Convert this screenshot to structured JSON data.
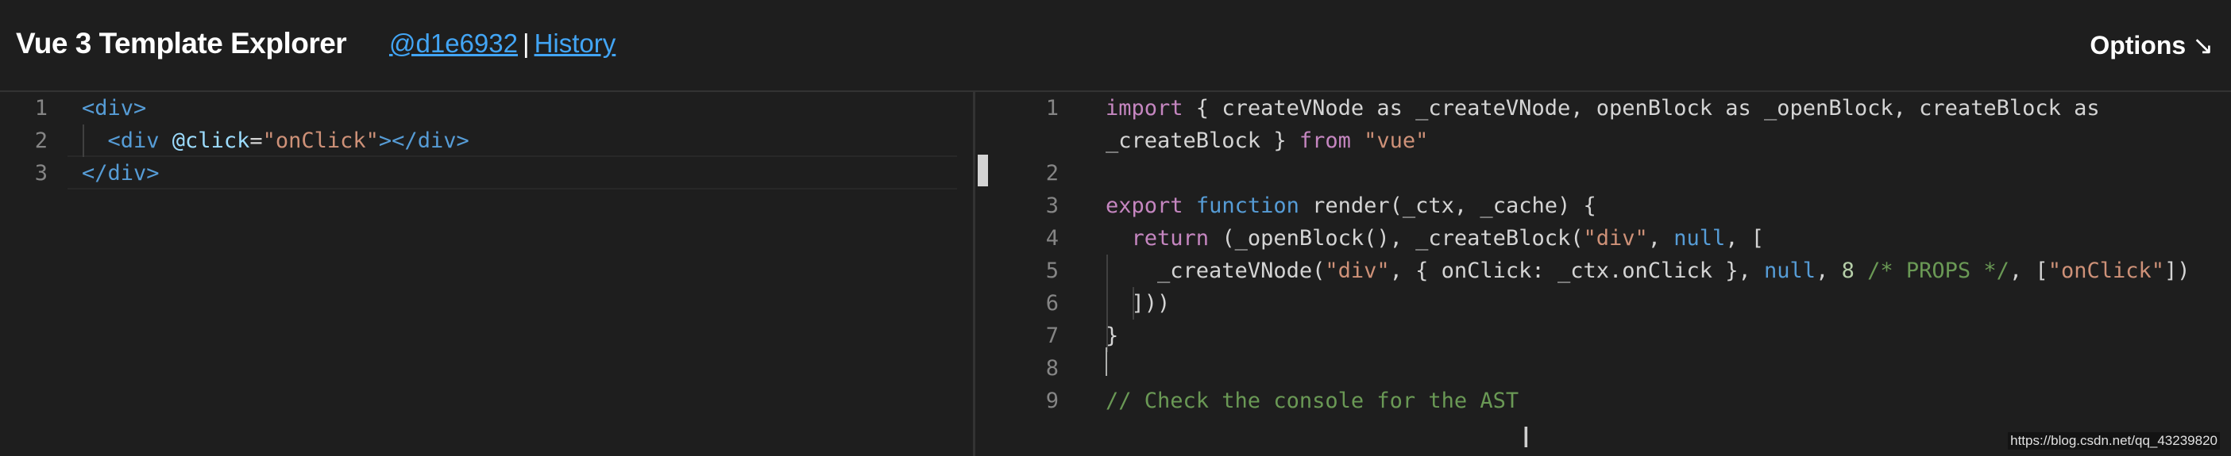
{
  "header": {
    "title": "Vue 3 Template Explorer",
    "commit_link": "@d1e6932",
    "separator": "|",
    "history_link": "History",
    "options_label": "Options",
    "options_arrow": "↘"
  },
  "editor": {
    "line_numbers": [
      "1",
      "2",
      "3"
    ],
    "lines": [
      [
        {
          "t": "<div>",
          "c": "tag"
        }
      ],
      [
        {
          "t": "  ",
          "c": "plain"
        },
        {
          "t": "<div ",
          "c": "tag"
        },
        {
          "t": "@click",
          "c": "attr"
        },
        {
          "t": "=",
          "c": "plain"
        },
        {
          "t": "\"onClick\"",
          "c": "str"
        },
        {
          "t": "></div>",
          "c": "tag"
        }
      ],
      [
        {
          "t": "</div>",
          "c": "tag"
        }
      ]
    ]
  },
  "output": {
    "line_numbers": [
      "1",
      "",
      "2",
      "3",
      "4",
      "5",
      "6",
      "7",
      "8",
      "9"
    ],
    "lines": [
      [
        {
          "t": "import",
          "c": "ctrl"
        },
        {
          "t": " { createVNode as _createVNode, openBlock as _openBlock, createBlock as",
          "c": "plain"
        }
      ],
      [
        {
          "t": "_createBlock } ",
          "c": "plain"
        },
        {
          "t": "from",
          "c": "ctrl"
        },
        {
          "t": " ",
          "c": "plain"
        },
        {
          "t": "\"vue\"",
          "c": "str"
        }
      ],
      [],
      [
        {
          "t": "export",
          "c": "ctrl"
        },
        {
          "t": " ",
          "c": "plain"
        },
        {
          "t": "function",
          "c": "kw"
        },
        {
          "t": " render(_ctx, _cache) {",
          "c": "plain"
        }
      ],
      [
        {
          "t": "  ",
          "c": "plain"
        },
        {
          "t": "return",
          "c": "ctrl"
        },
        {
          "t": " (_openBlock(), _createBlock(",
          "c": "plain"
        },
        {
          "t": "\"div\"",
          "c": "str"
        },
        {
          "t": ", ",
          "c": "plain"
        },
        {
          "t": "null",
          "c": "kw"
        },
        {
          "t": ", [",
          "c": "plain"
        }
      ],
      [
        {
          "t": "    _createVNode(",
          "c": "plain"
        },
        {
          "t": "\"div\"",
          "c": "str"
        },
        {
          "t": ", { onClick: _ctx.onClick }, ",
          "c": "plain"
        },
        {
          "t": "null",
          "c": "kw"
        },
        {
          "t": ", ",
          "c": "plain"
        },
        {
          "t": "8",
          "c": "num"
        },
        {
          "t": " ",
          "c": "plain"
        },
        {
          "t": "/* PROPS */",
          "c": "cmt"
        },
        {
          "t": ", [",
          "c": "plain"
        },
        {
          "t": "\"onClick\"",
          "c": "str"
        },
        {
          "t": "])",
          "c": "plain"
        }
      ],
      [
        {
          "t": "  ]))",
          "c": "plain"
        }
      ],
      [
        {
          "t": "}",
          "c": "plain"
        }
      ],
      [],
      [
        {
          "t": "// Check the console for the AST",
          "c": "cmt"
        }
      ]
    ]
  },
  "watermark": "https://blog.csdn.net/qq_43239820",
  "colors": {
    "background": "#1e1e1e",
    "tag": "#569cd6",
    "attribute": "#9cdcfe",
    "string": "#ce9178",
    "keyword": "#569cd6",
    "control": "#c586c0",
    "number": "#b5cea8",
    "comment": "#6a9955",
    "link": "#42a5f5"
  }
}
